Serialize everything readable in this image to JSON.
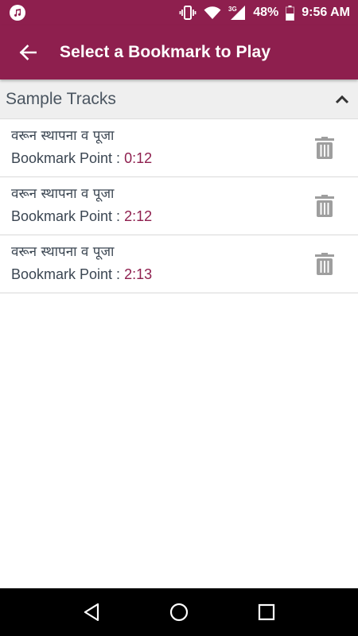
{
  "status_bar": {
    "signal_label": "3G",
    "battery": "48%",
    "time": "9:56 AM"
  },
  "app_bar": {
    "title": "Select a Bookmark to Play"
  },
  "group": {
    "title": "Sample Tracks",
    "expanded": true
  },
  "bookmarks": [
    {
      "track": "वरून स्थापना व पूजा",
      "label": "Bookmark Point : ",
      "time": "0:12"
    },
    {
      "track": "वरून स्थापना व पूजा",
      "label": "Bookmark Point : ",
      "time": "2:12"
    },
    {
      "track": "वरून स्थापना व पूजा",
      "label": "Bookmark Point : ",
      "time": "2:13"
    }
  ],
  "colors": {
    "primary": "#8e1f4e",
    "text": "#3b4652",
    "icon_gray": "#9e9e9e"
  },
  "icons": {
    "back": "arrow-left-icon",
    "collapse": "chevron-up-icon",
    "delete": "trash-icon",
    "nav_back": "triangle-back-icon",
    "nav_home": "circle-home-icon",
    "nav_recents": "square-recents-icon"
  }
}
